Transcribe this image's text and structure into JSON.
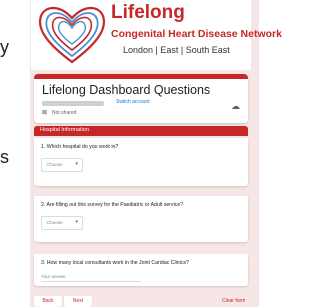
{
  "banner": {
    "title": "Lifelong",
    "subtitle": "Congenital Heart Disease Network",
    "locations": "London | East | South East"
  },
  "form": {
    "title": "Lifelong Dashboard Questions",
    "switch_account": "Switch account",
    "not_shared": "Not shared"
  },
  "section": {
    "label": "Hospital Information"
  },
  "questions": [
    {
      "text": "1. Which hospital do you work in?",
      "placeholder": "Choose"
    },
    {
      "text": "2. Are filling out this survey for the Paediatric or Adult service?",
      "placeholder": "Choose"
    },
    {
      "text": "3. How many local consultants work in the Joint Cardiac Clinics?",
      "placeholder": "Your answer"
    }
  ],
  "nav": {
    "back": "Back",
    "next": "Next",
    "clear": "Clear form"
  },
  "artifacts": [
    "y",
    "s"
  ],
  "colors": {
    "brand": "#c62828",
    "page_bg": "#f7e6e6"
  }
}
